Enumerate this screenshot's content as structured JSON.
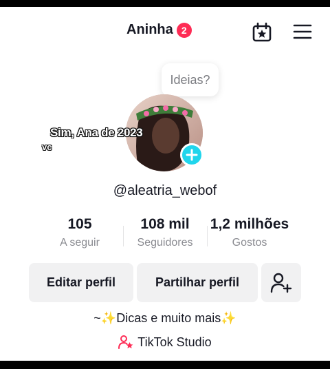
{
  "header": {
    "title": "Aninha",
    "badge_count": "2",
    "calendar_icon": "calendar-star-icon",
    "menu_icon": "hamburger-menu-icon"
  },
  "bubble": {
    "text": "Ideias?"
  },
  "overlay": {
    "line1": "Sim, Ana de 2023",
    "line2": "vc"
  },
  "profile": {
    "username": "@aleatria_webof"
  },
  "stats": [
    {
      "value": "105",
      "label": "A seguir"
    },
    {
      "value": "108 mil",
      "label": "Seguidores"
    },
    {
      "value": "1,2 milhões",
      "label": "Gostos"
    }
  ],
  "buttons": {
    "edit": "Editar perfil",
    "share": "Partilhar perfil",
    "add_friend_icon": "add-user-icon"
  },
  "bio": "~✨Dicas e muito mais✨",
  "studio": {
    "label": "TikTok Studio",
    "icon": "tiktok-studio-icon"
  },
  "colors": {
    "accent": "#fe2c55",
    "plus": "#20d5ec",
    "button_bg": "#f1f1f2"
  }
}
